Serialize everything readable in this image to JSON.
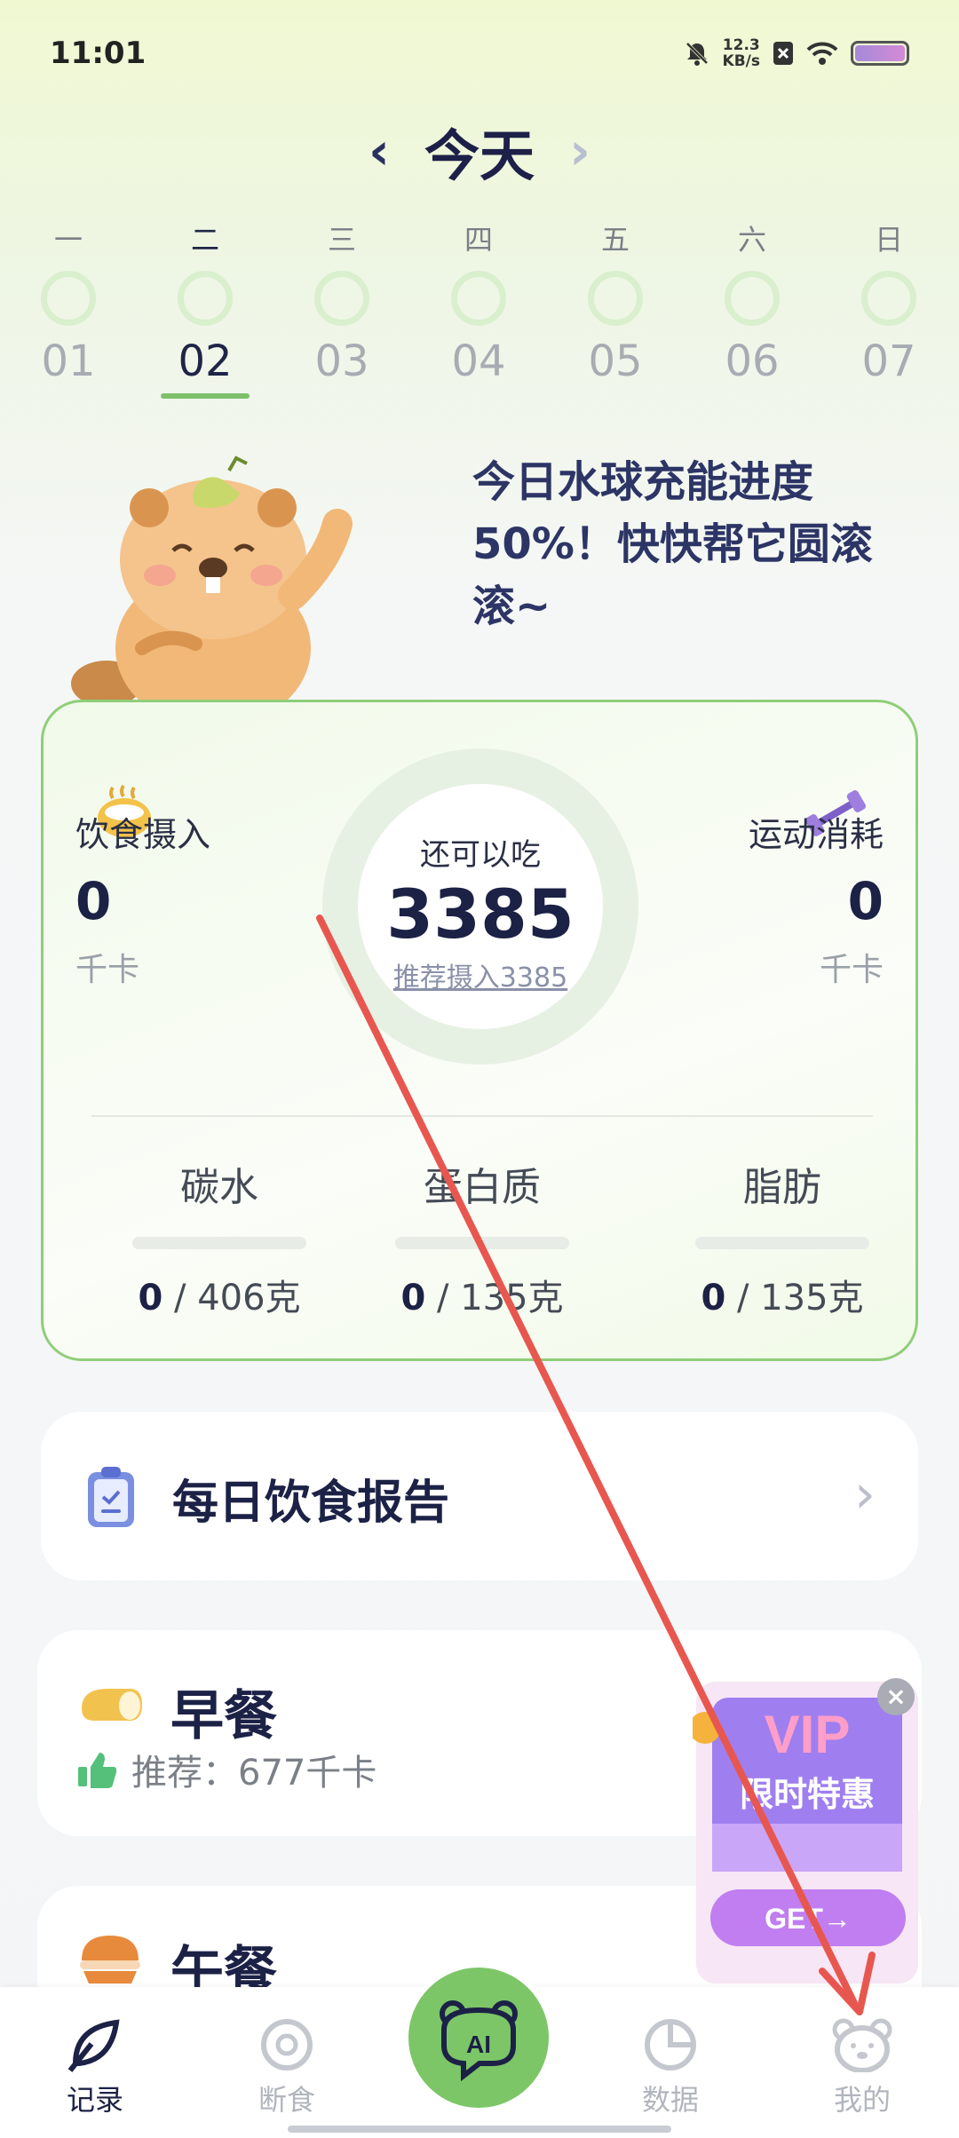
{
  "status": {
    "time": "11:01",
    "net_speed": "12.3",
    "net_unit": "KB/s"
  },
  "header": {
    "title": "今天",
    "prev_icon": "chevron-left-icon",
    "next_icon": "chevron-right-icon"
  },
  "week": [
    {
      "weekday": "一",
      "date": "01"
    },
    {
      "weekday": "二",
      "date": "02",
      "selected": true
    },
    {
      "weekday": "三",
      "date": "03"
    },
    {
      "weekday": "四",
      "date": "04"
    },
    {
      "weekday": "五",
      "date": "05"
    },
    {
      "weekday": "六",
      "date": "06"
    },
    {
      "weekday": "日",
      "date": "07"
    }
  ],
  "mascot_message": "今日水球充能进度50%！快快帮它圆滚滚~",
  "summary": {
    "intake_label": "饮食摄入",
    "intake_value": "0",
    "intake_unit": "千卡",
    "burn_label": "运动消耗",
    "burn_value": "0",
    "burn_unit": "千卡",
    "remaining_label": "还可以吃",
    "remaining_value": "3385",
    "recommended_text": "推荐摄入3385"
  },
  "macros": [
    {
      "name": "碳水",
      "current": "0",
      "target": " / 406克"
    },
    {
      "name": "蛋白质",
      "current": "0",
      "target": " / 135克"
    },
    {
      "name": "脂肪",
      "current": "0",
      "target": " / 135克"
    }
  ],
  "report": {
    "label": "每日饮食报告"
  },
  "meals": [
    {
      "name": "早餐",
      "recommend": "推荐：677千卡"
    },
    {
      "name": "午餐"
    }
  ],
  "promo": {
    "title": "VIP",
    "subtitle": "限时特惠",
    "cta": "GET→"
  },
  "tabs": [
    {
      "label": "记录",
      "icon": "leaf-pen-icon",
      "active": true
    },
    {
      "label": "断食",
      "icon": "ring-icon"
    },
    {
      "label": "AI",
      "icon": "ai-bear-icon"
    },
    {
      "label": "数据",
      "icon": "pie-chart-icon"
    },
    {
      "label": "我的",
      "icon": "bear-face-icon"
    }
  ],
  "colors": {
    "accent": "#7cc667",
    "annotation_arrow": "#e8574f",
    "text_dark": "#1c2146"
  }
}
